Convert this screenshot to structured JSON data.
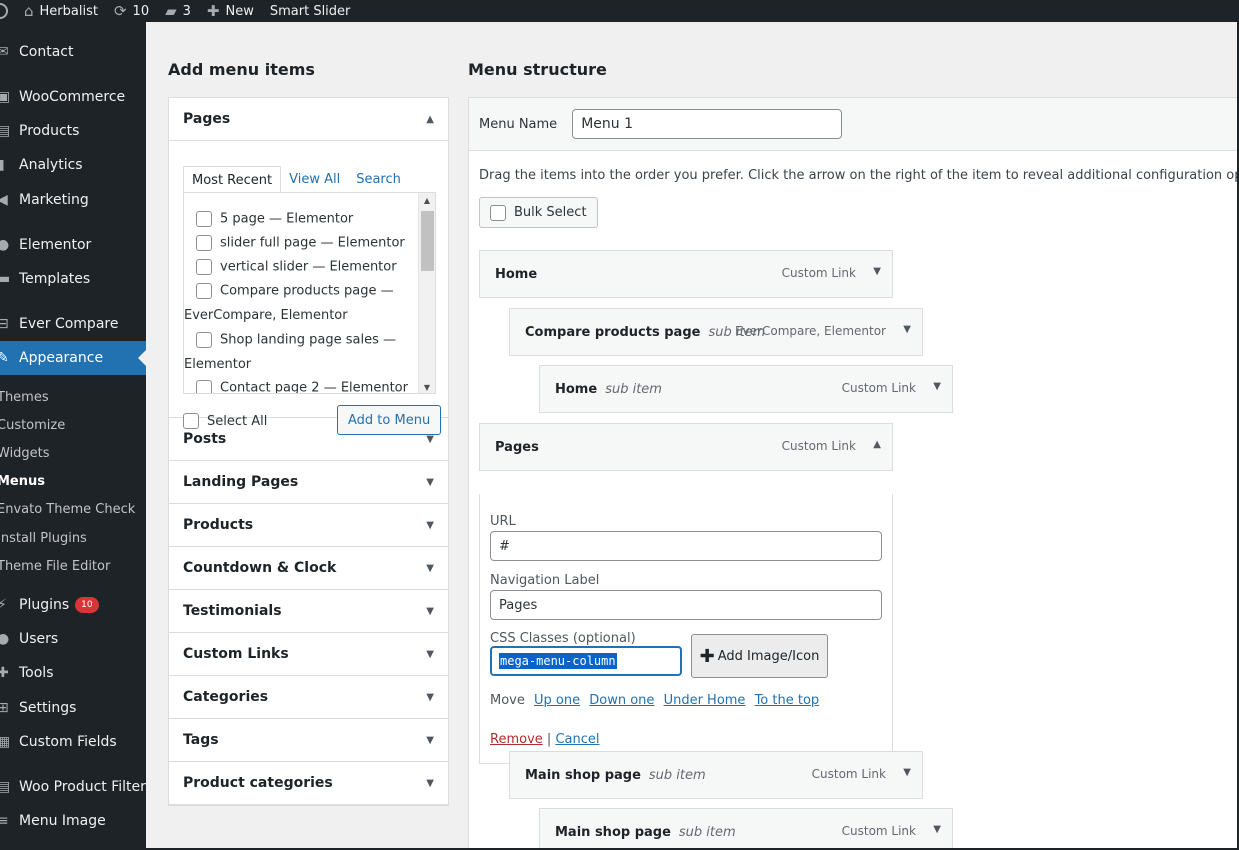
{
  "adminbar": {
    "site_name": "Herbalist",
    "updates_count": "10",
    "comments_count": "3",
    "new_label": "New",
    "smart_slider": "Smart Slider"
  },
  "sidebar": {
    "items": [
      {
        "label": "Contact",
        "icon": "envelope-icon",
        "glyph": "✉"
      },
      {
        "label": "WooCommerce",
        "icon": "woo-icon",
        "glyph": "▣"
      },
      {
        "label": "Products",
        "icon": "archive-icon",
        "glyph": "▤"
      },
      {
        "label": "Analytics",
        "icon": "chart-bar-icon",
        "glyph": "▮"
      },
      {
        "label": "Marketing",
        "icon": "megaphone-icon",
        "glyph": "◀"
      },
      {
        "label": "Elementor",
        "icon": "elementor-icon",
        "glyph": "●"
      },
      {
        "label": "Templates",
        "icon": "folder-icon",
        "glyph": "▬"
      },
      {
        "label": "Ever Compare",
        "icon": "compare-icon",
        "glyph": "⊟"
      },
      {
        "label": "Appearance",
        "icon": "paintbrush-icon",
        "glyph": "✎"
      },
      {
        "label": "Plugins",
        "icon": "plug-icon",
        "glyph": "⚡"
      },
      {
        "label": "Users",
        "icon": "users-icon",
        "glyph": "●"
      },
      {
        "label": "Tools",
        "icon": "wrench-icon",
        "glyph": "✚"
      },
      {
        "label": "Settings",
        "icon": "settings-icon",
        "glyph": "⊞"
      },
      {
        "label": "Custom Fields",
        "icon": "grid-icon",
        "glyph": "▦"
      },
      {
        "label": "Woo Product Filter",
        "icon": "filter-icon",
        "glyph": "▤"
      },
      {
        "label": "Menu Image",
        "icon": "menu-icon",
        "glyph": "≡"
      }
    ],
    "plugins_badge": "10",
    "submenu": [
      "Themes",
      "Customize",
      "Widgets",
      "Menus",
      "Envato Theme Check",
      "Install Plugins",
      "Theme File Editor"
    ]
  },
  "left": {
    "heading": "Add menu items",
    "pages_title": "Pages",
    "tabs": [
      "Most Recent",
      "View All",
      "Search"
    ],
    "pages": [
      "5 page — Elementor",
      "slider full page — Elementor",
      "vertical slider — Elementor",
      "Compare products page —",
      "EverCompare, Elementor",
      "Shop landing page sales —",
      "Elementor",
      "Contact page 2 — Elementor"
    ],
    "select_all": "Select All",
    "add_to_menu": "Add to Menu",
    "sections": [
      "Posts",
      "Landing Pages",
      "Products",
      "Countdown & Clock",
      "Testimonials",
      "Custom Links",
      "Categories",
      "Tags",
      "Product categories"
    ]
  },
  "right": {
    "heading": "Menu structure",
    "menu_name_label": "Menu Name",
    "menu_name_value": "Menu 1",
    "instructions": "Drag the items into the order you prefer. Click the arrow on the right of the item to reveal additional configuration options.",
    "bulk_select": "Bulk Select",
    "sub_item": "sub item",
    "items": [
      {
        "title": "Home",
        "type": "Custom Link"
      },
      {
        "title": "Compare products page",
        "type": "EverCompare, Elementor"
      },
      {
        "title": "Home",
        "type": "Custom Link"
      },
      {
        "title": "Pages",
        "type": "Custom Link"
      },
      {
        "title": "Main shop page",
        "type": "Custom Link"
      },
      {
        "title": "Main shop page",
        "type": "Custom Link"
      }
    ],
    "settings": {
      "url_label": "URL",
      "url_value": "#",
      "nav_label": "Navigation Label",
      "nav_value": "Pages",
      "css_label": "CSS Classes (optional)",
      "css_value": "mega-menu-column",
      "add_image": "Add Image/Icon",
      "move_label": "Move",
      "move_links": [
        "Up one",
        "Down one",
        "Under Home",
        "To the top"
      ],
      "remove": "Remove",
      "separator": "|",
      "cancel": "Cancel"
    }
  }
}
